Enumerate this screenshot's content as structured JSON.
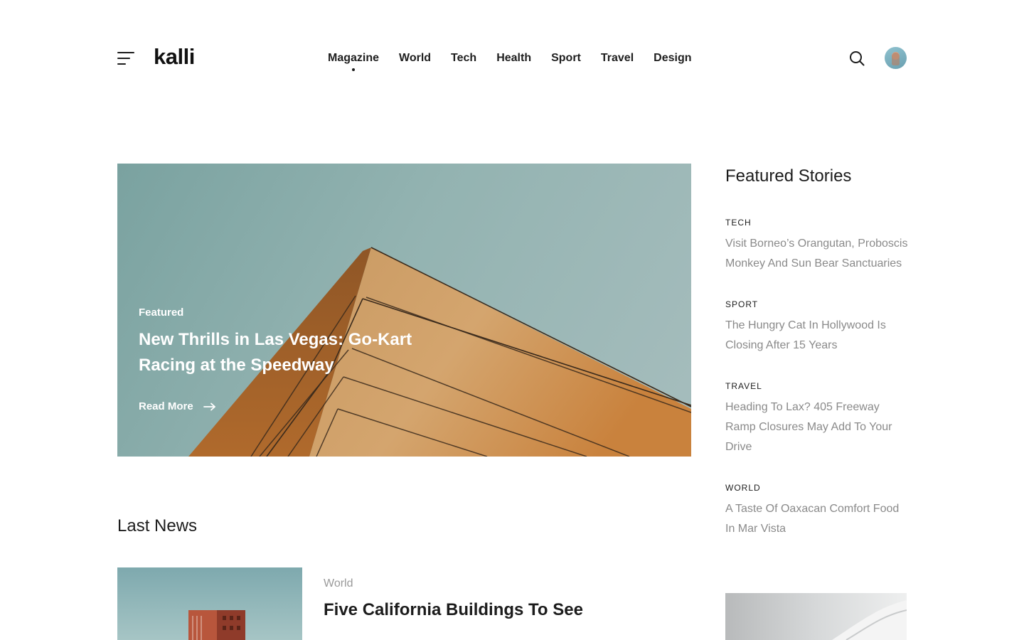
{
  "brand": {
    "name": "kalli"
  },
  "nav": {
    "items": [
      {
        "label": "Magazine",
        "active": true
      },
      {
        "label": "World",
        "active": false
      },
      {
        "label": "Tech",
        "active": false
      },
      {
        "label": "Health",
        "active": false
      },
      {
        "label": "Sport",
        "active": false
      },
      {
        "label": "Travel",
        "active": false
      },
      {
        "label": "Design",
        "active": false
      }
    ]
  },
  "icons": {
    "menu": "hamburger-icon",
    "search": "search-icon",
    "arrow": "arrow-right-icon"
  },
  "hero": {
    "label": "Featured",
    "title": "New Thrills in Las Vegas: Go-Kart Racing at the Speedway",
    "read_more": "Read More"
  },
  "last_news": {
    "heading": "Last News",
    "items": [
      {
        "category": "World",
        "title": "Five California Buildings To See"
      }
    ]
  },
  "featured_stories": {
    "heading": "Featured Stories",
    "items": [
      {
        "category": "TECH",
        "title": "Visit Borneo’s Orangutan, Proboscis Monkey And Sun Bear Sanctuaries"
      },
      {
        "category": "SPORT",
        "title": "The Hungry Cat In Hollywood Is Closing After 15 Years"
      },
      {
        "category": "TRAVEL",
        "title": "Heading To Lax? 405 Freeway Ramp Closures May Add To Your Drive"
      },
      {
        "category": "WORLD",
        "title": "A Taste Of Oaxacan Comfort Food In Mar Vista"
      }
    ]
  },
  "colors": {
    "text": "#1c1c1c",
    "muted": "#8a8a8a",
    "hero_sky": "#93b3b1",
    "hero_building": "#c98a4a"
  }
}
